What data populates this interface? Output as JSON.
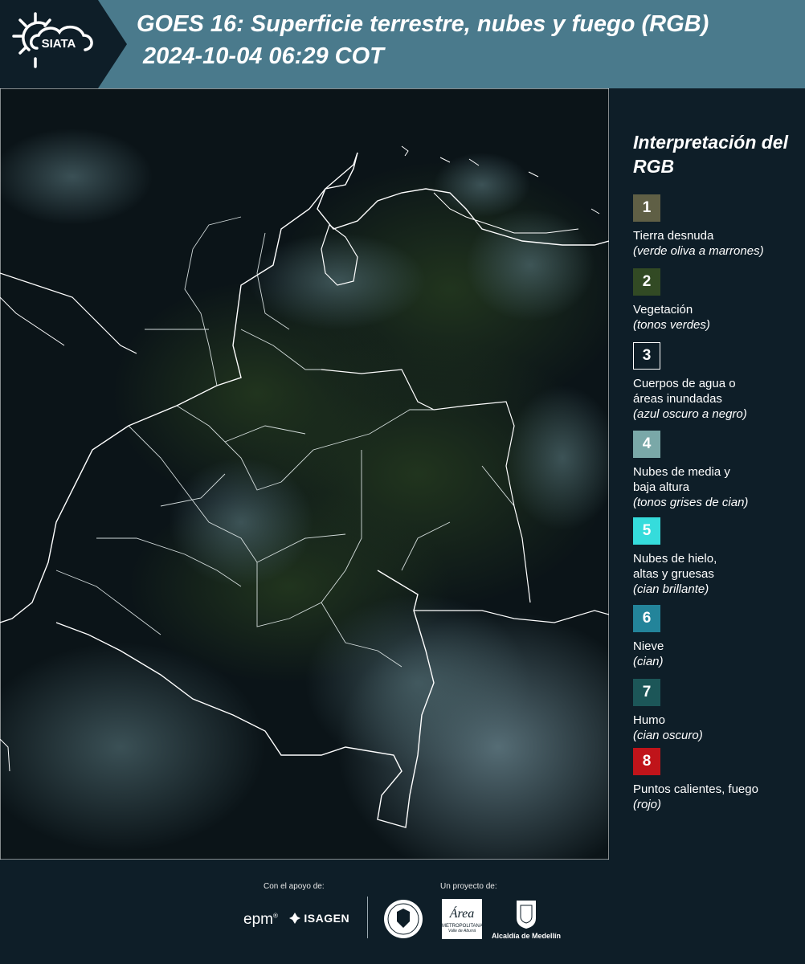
{
  "header": {
    "logo_text": "SIATA",
    "title_line1": "GOES 16: Superficie terrestre, nubes y fuego (RGB)",
    "title_line2": "2024-10-04 06:29 COT"
  },
  "legend": {
    "title": "Interpretación del RGB",
    "items": [
      {
        "number": "1",
        "label": "Tierra desnuda",
        "sub": "(verde oliva a marrones)",
        "color": "#5f5f45",
        "border": "#5f5f45"
      },
      {
        "number": "2",
        "label": "Vegetación",
        "sub": "(tonos verdes)",
        "color": "#324a24",
        "border": "#324a24"
      },
      {
        "number": "3",
        "label": "Cuerpos de agua o\náreas inundadas",
        "sub": "(azul oscuro a negro)",
        "color": "#0e1e28",
        "border": "#ffffff"
      },
      {
        "number": "4",
        "label": "Nubes de media y\nbaja altura",
        "sub": "(tonos grises de cian)",
        "color": "#7aa8a8",
        "border": "#7aa8a8"
      },
      {
        "number": "5",
        "label": "Nubes de hielo,\naltas y gruesas",
        "sub": "(cian brillante)",
        "color": "#35dcdc",
        "border": "#35dcdc"
      },
      {
        "number": "6",
        "label": "Nieve",
        "sub": "(cian)",
        "color": "#23849a",
        "border": "#23849a"
      },
      {
        "number": "7",
        "label": "Humo",
        "sub": "(cian oscuro)",
        "color": "#1c5658",
        "border": "#1c5658"
      },
      {
        "number": "8",
        "label": "Puntos calientes, fuego",
        "sub": "(rojo)",
        "color": "#c0141a",
        "border": "#c0141a"
      }
    ]
  },
  "footer": {
    "support_label": "Con el apoyo de:",
    "project_label": "Un proyecto de:",
    "sponsor_epm": "epm",
    "sponsor_isagen": "ISAGEN",
    "area_metro_text": "Área",
    "area_metro_sub": "METROPOLITANA",
    "area_metro_sub2": "Valle de Aburrá",
    "alcaldia": "Alcaldía de Medellín"
  }
}
